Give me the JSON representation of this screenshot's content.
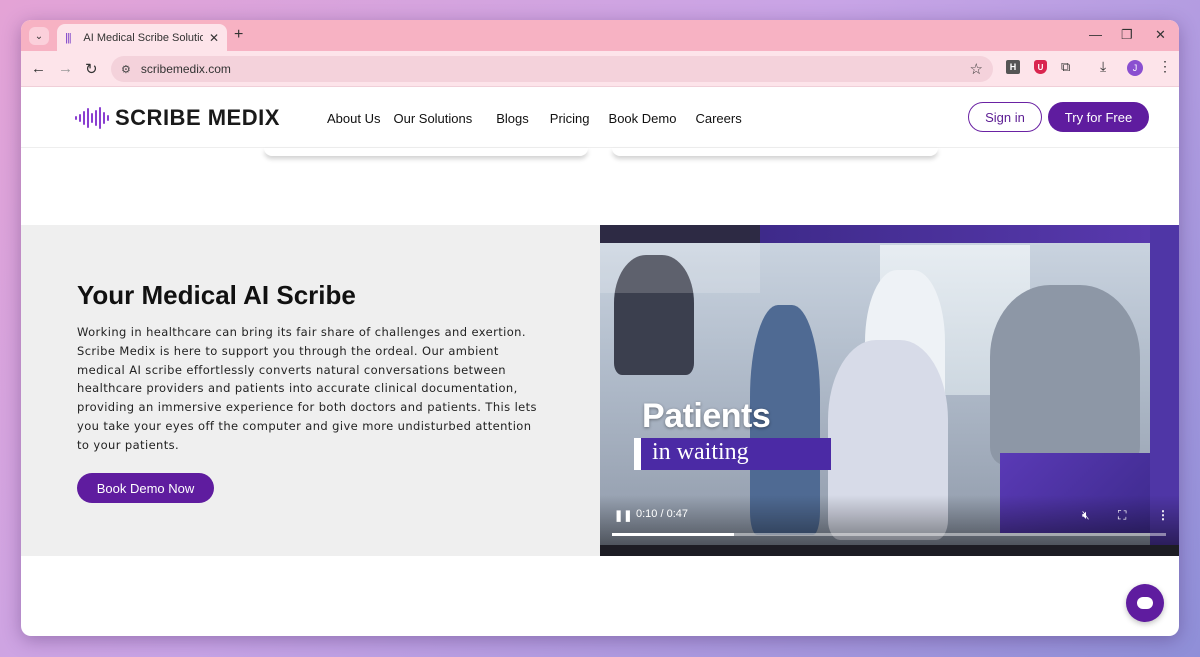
{
  "browser": {
    "tab_title": "AI Medical Scribe Solution for H",
    "tab_close": "✕",
    "new_tab": "+",
    "url": "scribemedix.com",
    "controls": {
      "minimize": "—",
      "restore": "❐",
      "close": "✕"
    },
    "nav": {
      "back": "←",
      "forward": "→",
      "reload": "↻"
    },
    "ext_h": "H",
    "ext_shield": "U",
    "avatar_letter": "J"
  },
  "site": {
    "logo_text": "SCRIBE MEDIX",
    "nav_items": [
      "About Us",
      "Our Solutions",
      "Blogs",
      "Pricing",
      "Book Demo",
      "Careers"
    ],
    "sign_in": "Sign in",
    "try_free": "Try for Free"
  },
  "hero": {
    "title": "Your Medical AI Scribe",
    "paragraph": "Working in healthcare can bring its fair share of challenges and exertion. Scribe Medix is here to support you through the ordeal. Our ambient medical AI scribe effortlessly converts natural conversations between healthcare providers and patients into accurate clinical documentation, providing an immersive experience for both doctors and patients. This lets you take your eyes off the computer and give more undisturbed attention to your patients.",
    "button": "Book Demo Now"
  },
  "video": {
    "title": "Patients",
    "subtitle": "in waiting",
    "time": "0:10 / 0:47",
    "progress": 0.22,
    "play_icon": "pause-icon",
    "mute_icon": "muted-icon"
  },
  "colors": {
    "brand": "#5f1c9f",
    "tab_strip": "#f7b2c3"
  }
}
